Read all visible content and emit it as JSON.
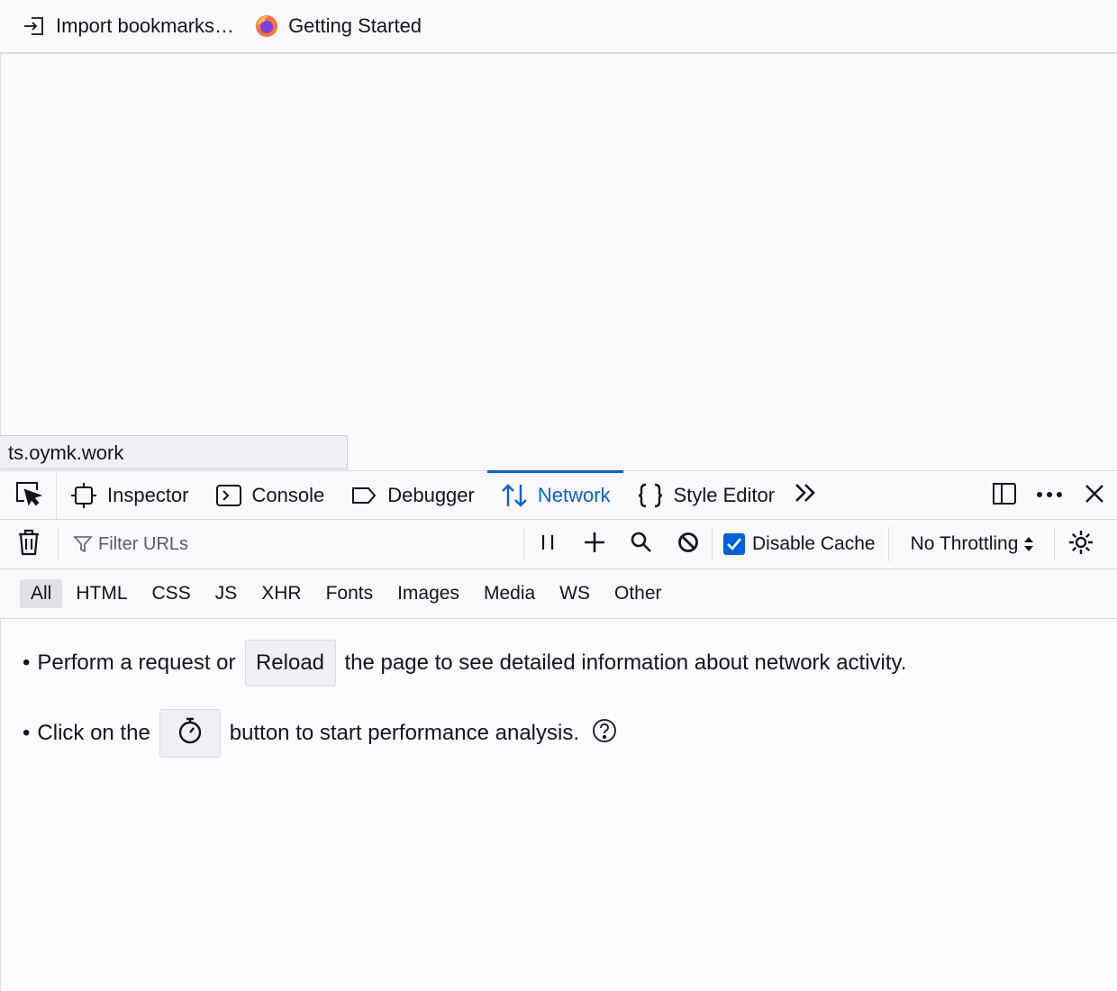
{
  "bookmarks": {
    "import_label": "Import bookmarks…",
    "getting_started_label": "Getting Started"
  },
  "status_url": "ts.oymk.work",
  "devtools": {
    "tabs": {
      "inspector": "Inspector",
      "console": "Console",
      "debugger": "Debugger",
      "network": "Network",
      "style_editor": "Style Editor"
    },
    "active_tab": "Network",
    "accent_color": "#0061e0"
  },
  "toolbar": {
    "filter_placeholder": "Filter URLs",
    "disable_cache_label": "Disable Cache",
    "disable_cache_checked": true,
    "throttling_label": "No Throttling"
  },
  "type_filters": {
    "all": "All",
    "html": "HTML",
    "css": "CSS",
    "js": "JS",
    "xhr": "XHR",
    "fonts": "Fonts",
    "images": "Images",
    "media": "Media",
    "ws": "WS",
    "other": "Other"
  },
  "empty_state": {
    "line1_prefix": "Perform a request or",
    "reload_label": "Reload",
    "line1_suffix": "the page to see detailed information about network activity.",
    "line2_prefix": "Click on the",
    "line2_suffix": "button to start performance analysis."
  },
  "icons": [
    "import-icon",
    "firefox-icon",
    "element-picker-icon",
    "inspector-icon",
    "console-icon",
    "debugger-icon",
    "network-icon",
    "style-editor-icon",
    "more-tabs-icon",
    "dock-icon",
    "meatball-menu-icon",
    "close-icon",
    "trash-icon",
    "filter-icon",
    "pause-icon",
    "add-icon",
    "search-icon",
    "block-icon",
    "checkbox-icon",
    "dropdown-arrows-icon",
    "settings-icon",
    "stopwatch-icon",
    "help-icon"
  ]
}
